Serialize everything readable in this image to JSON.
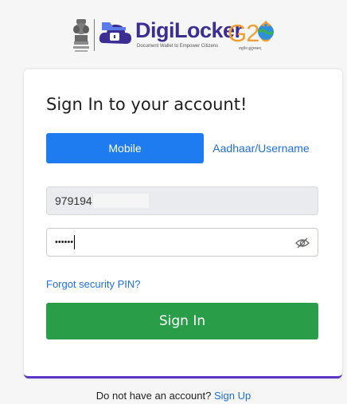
{
  "header": {
    "brand_name": "DigiLocker",
    "tagline": "Document Wallet to Empower Citizens",
    "g20_label": "G20",
    "g20_sub": "वसुधैव कुटुम्बकम्"
  },
  "form": {
    "title": "Sign In to your account!",
    "tabs": [
      {
        "label": "Mobile",
        "active": true
      },
      {
        "label": "Aadhaar/Username",
        "active": false
      }
    ],
    "mobile_value": "979194",
    "pin_value": "••••••",
    "forgot_label": "Forgot security PIN?",
    "signin_label": "Sign In"
  },
  "footer": {
    "prompt": "Do not have an account?",
    "signup_label": "Sign Up"
  },
  "colors": {
    "primary_blue": "#1f7cf0",
    "link_blue": "#1f6fe0",
    "signin_green": "#2a9d49",
    "brand_purple": "#3b2d93",
    "card_accent": "#5a37c9"
  },
  "icons": [
    "national-emblem-icon",
    "digilocker-cloud-icon",
    "g20-globe-icon",
    "eye-off-icon"
  ]
}
